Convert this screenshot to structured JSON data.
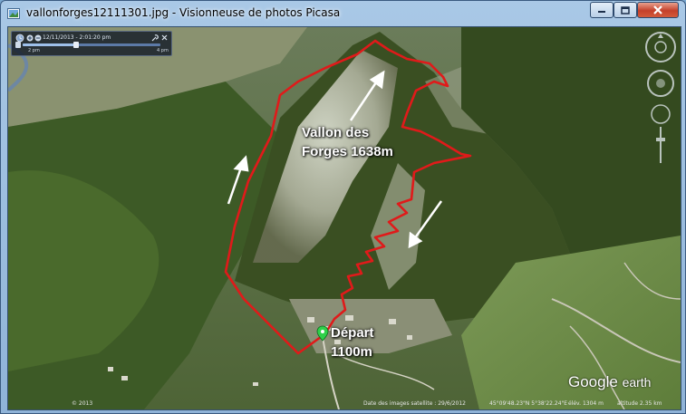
{
  "window": {
    "title": "vallonforges12111301.jpg - Visionneuse de photos Picasa"
  },
  "overlay": {
    "vallon_line1": "Vallon des",
    "vallon_line2": "Forges 1638m",
    "depart_line1": "Départ",
    "depart_line2": "1100m"
  },
  "timebar": {
    "date": "12/11/2013 - 2:01:20 pm",
    "start": "2 pm",
    "end": "4 pm"
  },
  "status": {
    "copyright": "© 2013",
    "imagery_date": "Date des images satellite : 29/6/2012",
    "coords": "45°09'48.23\"N  5°38'22.24\"E",
    "elevation": "élév. 1304 m",
    "altitude": "altitude 2.35 km"
  },
  "logo": {
    "google": "Google",
    "earth": "earth"
  },
  "colors": {
    "track": "#e01a1a",
    "frame": "#8fb3d8",
    "close_button": "#c4402a"
  }
}
